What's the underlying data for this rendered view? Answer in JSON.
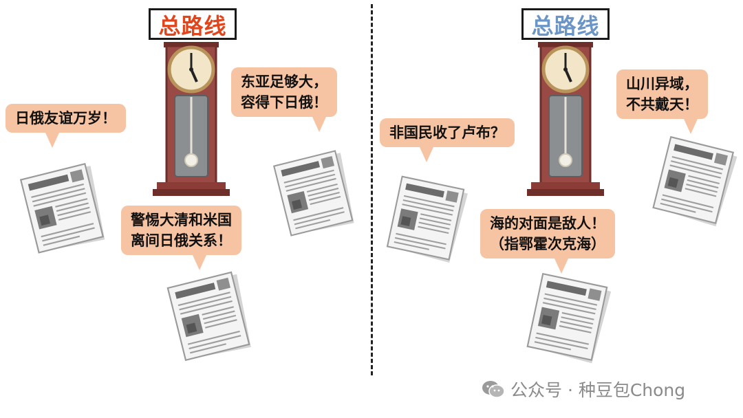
{
  "left": {
    "title": "总路线",
    "bubbles": [
      {
        "text": "日俄友谊万岁！"
      },
      {
        "line1": "东亚足够大，",
        "line2": "容得下日俄！"
      },
      {
        "line1": "警惕大清和米国",
        "line2": "离间日俄关系！"
      }
    ]
  },
  "right": {
    "title": "总路线",
    "bubbles": [
      {
        "text": "非国民收了卢布？"
      },
      {
        "line1": "山川异域，",
        "line2": "不共戴天！"
      },
      {
        "line1": "海的对面是敌人！",
        "line2": "（指鄂霍次克海）"
      }
    ]
  },
  "watermark": {
    "text": "公众号 · 种豆包Chong"
  },
  "colors": {
    "bubble": "#f6c3a3",
    "clock_wood": "#9a4a44",
    "title_red": "#e0451c",
    "title_blue": "#6b95c6"
  }
}
